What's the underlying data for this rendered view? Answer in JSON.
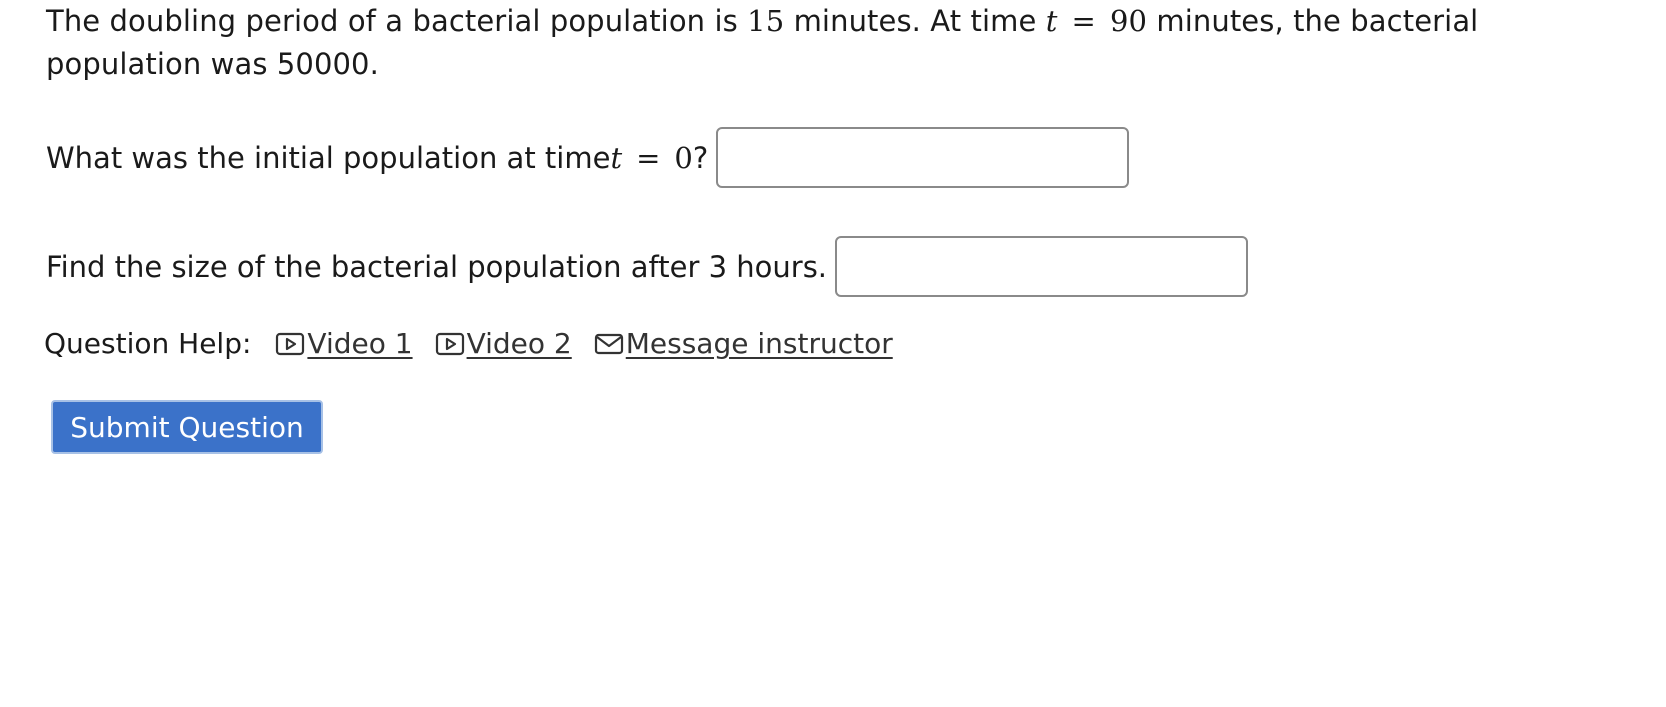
{
  "question": {
    "intro": {
      "part1": "The doubling period of a bacterial population is ",
      "doubling_value": "15",
      "part2": " minutes. At time ",
      "var_t": "t",
      "equals": "=",
      "time_value": "90",
      "part3": " minutes, the bacterial population was 50000."
    },
    "q1": {
      "prefix": "What was the initial population at time ",
      "var_t": "t",
      "equals": "=",
      "value": "0",
      "suffix": "?",
      "input_value": ""
    },
    "q2": {
      "label": "Find the size of the bacterial population after 3 hours.",
      "input_value": ""
    }
  },
  "help": {
    "label": "Question Help:",
    "links": [
      {
        "label": "Video 1",
        "icon": "video-icon"
      },
      {
        "label": "Video 2",
        "icon": "video-icon"
      },
      {
        "label": "Message instructor",
        "icon": "envelope-icon"
      }
    ]
  },
  "submit": {
    "label": "Submit Question",
    "color": "#3b72c9"
  }
}
